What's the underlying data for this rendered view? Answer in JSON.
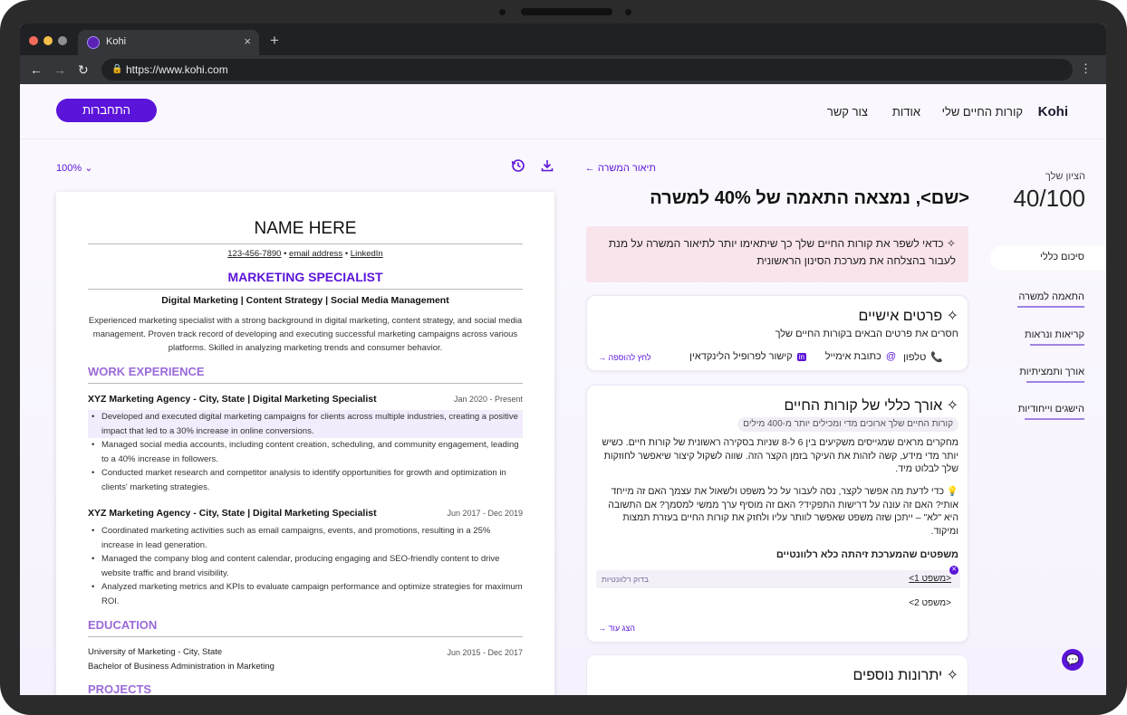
{
  "browser": {
    "tab_title": "Kohi",
    "tab_close": "×",
    "new_tab": "+",
    "url": "https://www.kohi.com",
    "back": "←",
    "forward": "→",
    "reload": "↻",
    "menu": "⋮",
    "lock": "🔒"
  },
  "nav": {
    "logo": "Kohi",
    "links": [
      "קורות החיים שלי",
      "אודות",
      "צור קשר"
    ],
    "signup": "התחברות"
  },
  "preview": {
    "zoom": "100%",
    "zoom_chevron": "⌄",
    "resume": {
      "name": "NAME HERE",
      "phone": "123-456-7890",
      "sep": "•",
      "email": "email address",
      "linkedin": "LinkedIn",
      "title": "MARKETING SPECIALIST",
      "skills": "Digital Marketing | Content Strategy | Social Media Management",
      "summary": "Experienced marketing specialist with a strong background in digital marketing, content strategy, and social media management. Proven track record of developing and executing successful marketing campaigns across various platforms. Skilled in analyzing marketing trends and consumer behavior.",
      "work_heading": "WORK EXPERIENCE",
      "jobs": [
        {
          "title": "XYZ Marketing Agency - City, State  |  Digital Marketing Specialist",
          "date": "Jan 2020 - Present",
          "bullets": [
            "Developed and executed digital marketing campaigns for clients across multiple industries, creating a positive impact that led to a 30% increase in online conversions.",
            "Managed social media accounts, including content creation, scheduling, and community engagement, leading to a 40% increase in followers.",
            "Conducted market research and competitor analysis to identify opportunities for growth and optimization in clients' marketing strategies."
          ]
        },
        {
          "title": "XYZ Marketing Agency - City, State  |  Digital Marketing Specialist",
          "date": "Jun 2017 - Dec 2019",
          "bullets": [
            "Coordinated marketing activities such as email campaigns, events, and promotions, resulting in a 25% increase in lead generation.",
            "Managed the company blog and content calendar, producing engaging and SEO-friendly content to drive website traffic and brand visibility.",
            "Analyzed marketing metrics and KPIs to evaluate campaign performance and optimize strategies for maximum ROI."
          ]
        }
      ],
      "education_heading": "EDUCATION",
      "school": "University of Marketing - City, State",
      "school_date": "Jun 2015 - Dec 2017",
      "degree": "Bachelor of Business Administration in Marketing",
      "projects_heading": "PROJECTS"
    }
  },
  "review": {
    "back_link": "← תיאור המשרה",
    "headline": "<שם>, נמצאה התאמה של 40% למשרה",
    "score_label": "הציון שלך",
    "score": "40/100",
    "menu": [
      "סיכום כללי",
      "התאמה למשרה",
      "קריאות ונראות",
      "אורך ותמציתיות",
      "הישגים וייחודיות"
    ],
    "tip": "✧ כדאי לשפר את קורות החיים שלך כך שיתאימו יותר לתיאור המשרה על מנת לעבור בהצלחה את מערכת הסינון הראשונית",
    "personal": {
      "title": "✧ פרטים אישיים",
      "subtitle": "חסרים את פרטים הבאים בקורות החיים שלך",
      "fields": [
        "טלפון",
        "כתובת אימייל",
        "קישור לפרופיל הלינקדאין"
      ],
      "field_icons": [
        "phone-icon",
        "at-icon",
        "linkedin-icon"
      ],
      "cta": "לחץ להוספה →"
    },
    "length": {
      "title": "✧ אורך כללי של קורות החיים",
      "pill": "קורות החיים שלך ארוכים מדי ומכילים יותר מ-400 מילים",
      "para1": "מחקרים מראים שמגייסים משקיעים בין 6 ל-8 שניות בסקירה ראשונית של קורות חיים. כשיש יותר מדי מידע, קשה לזהות את העיקר בזמן הקצר הזה. שווה לשקול קיצור שיאפשר לחוזקות שלך לבלוט מיד.",
      "para2": "💡 כדי לדעת מה אפשר לקצר, נסה לעבור על כל משפט ולשאול את עצמך האם זה מייחד אותי? האם זה עונה על דרישות התפקיד? האם זה מוסיף ערך ממשי למסמך? אם התשובה היא \"לא\" – ייתכן שזה משפט שאפשר לוותר עליו ולחזק את קורות החיים בעזרת תמצות ומיקוד.",
      "sentences_title": "משפטים שהמערכת זיהתה כלא רלוונטיים",
      "sentences": [
        "<משפט 1>",
        "<משפט 2>"
      ],
      "check_tag": "בדוק רלוונטיות",
      "more": "הצג עוד →"
    },
    "extras": {
      "title": "✧ יתרונות נוספים"
    }
  },
  "colors": {
    "accent": "#5b14d9",
    "section": "#9a6ad8",
    "tip_bg": "#f9e4ec"
  }
}
